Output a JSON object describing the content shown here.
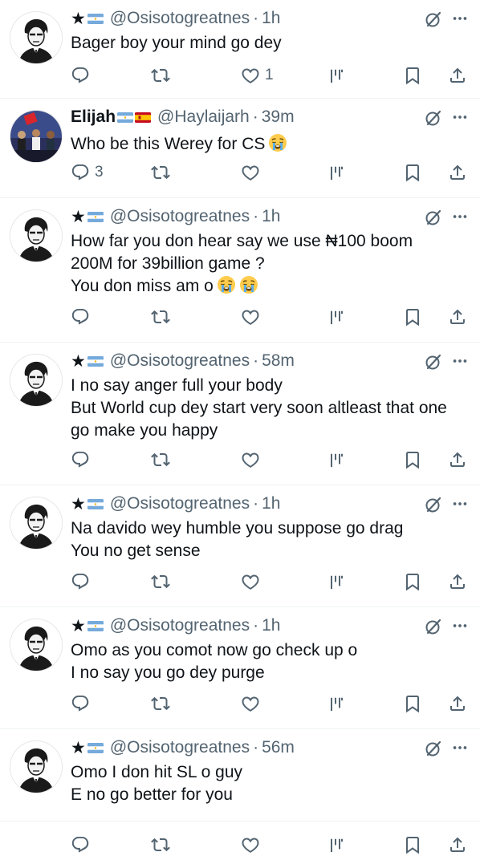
{
  "tweets": [
    {
      "star": "★",
      "handle": "@Osisotogreatnes",
      "dot": "·",
      "time": "1h",
      "lines": [
        "Bager boy your mind go dey"
      ],
      "reply_count": "",
      "like_count": "1"
    },
    {
      "name": "Elijah",
      "handle": "@Haylaijarh",
      "dot": "·",
      "time": "39m",
      "lines": [
        "Who be this Werey for CS"
      ],
      "reply_count": "3",
      "like_count": ""
    },
    {
      "star": "★",
      "handle": "@Osisotogreatnes",
      "dot": "·",
      "time": "1h",
      "lines": [
        "How far you don hear say we use ₦100 boom",
        "200M for 39billion game ?",
        "You don miss am o"
      ],
      "reply_count": "",
      "like_count": ""
    },
    {
      "star": "★",
      "handle": "@Osisotogreatnes",
      "dot": "·",
      "time": "58m",
      "lines": [
        "I no say anger full your body",
        "But World cup dey start very soon altleast that one",
        "go make you happy"
      ],
      "reply_count": "",
      "like_count": ""
    },
    {
      "star": "★",
      "handle": "@Osisotogreatnes",
      "dot": "·",
      "time": "1h",
      "lines": [
        "Na davido wey humble you suppose go drag",
        "You no get sense"
      ],
      "reply_count": "",
      "like_count": ""
    },
    {
      "star": "★",
      "handle": "@Osisotogreatnes",
      "dot": "·",
      "time": "1h",
      "lines": [
        "Omo as you comot now go check up o",
        "I no say you go dey purge"
      ],
      "reply_count": "",
      "like_count": ""
    },
    {
      "star": "★",
      "handle": "@Osisotogreatnes",
      "dot": "·",
      "time": "56m",
      "lines": [
        "Omo I don hit SL o guy",
        "E no go better for you"
      ],
      "reply_count": "",
      "like_count": ""
    }
  ],
  "icons": {
    "reply": "reply-icon",
    "retweet": "retweet-icon",
    "like": "heart-icon",
    "views": "views-icon",
    "bookmark": "bookmark-icon",
    "share": "share-icon",
    "grok": "grok-icon",
    "more": "more-icon",
    "crying_emoji": "crying-face-emoji"
  },
  "colors": {
    "text": "#0f1419",
    "muted": "#536471",
    "divider": "#eff3f4"
  }
}
